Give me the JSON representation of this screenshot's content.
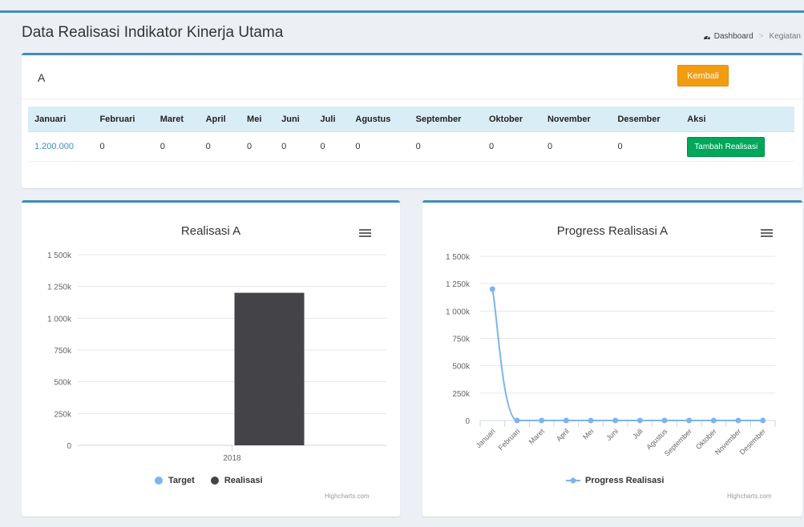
{
  "header": {
    "title": "Data Realisasi Indikator Kinerja Utama",
    "breadcrumb": [
      "Dashboard",
      "Kegiatan"
    ]
  },
  "indicator": {
    "name": "A",
    "back_label": "Kembali"
  },
  "table": {
    "headers": [
      "Januari",
      "Februari",
      "Maret",
      "April",
      "Mei",
      "Juni",
      "Juli",
      "Agustus",
      "September",
      "Oktober",
      "November",
      "Desember",
      "Aksi"
    ],
    "row": [
      "1.200.000",
      "0",
      "0",
      "0",
      "0",
      "0",
      "0",
      "0",
      "0",
      "0",
      "0",
      "0"
    ],
    "action_label": "Tambah Realisasi"
  },
  "colors": {
    "accent": "#3c8dbc",
    "warning": "#f39c12",
    "success": "#00a65a",
    "target": "#7cb5ec",
    "realisasi": "#434348"
  },
  "chart_data": [
    {
      "type": "bar",
      "title": "Realisasi A",
      "categories": [
        "2018"
      ],
      "series": [
        {
          "name": "Target",
          "values": [
            0
          ]
        },
        {
          "name": "Realisasi",
          "values": [
            1200000
          ]
        }
      ],
      "ylim": [
        0,
        1500000
      ],
      "yticks": [
        "0",
        "250k",
        "500k",
        "750k",
        "1 000k",
        "1 250k",
        "1 500k"
      ],
      "legend": "bottom-center",
      "credit": "Highcharts.com"
    },
    {
      "type": "line",
      "title": "Progress Realisasi A",
      "categories": [
        "Januari",
        "Februari",
        "Maret",
        "April",
        "Mei",
        "Juni",
        "Juli",
        "Agustus",
        "September",
        "Oktober",
        "November",
        "Desember"
      ],
      "series": [
        {
          "name": "Progress Realisasi",
          "values": [
            1200000,
            0,
            0,
            0,
            0,
            0,
            0,
            0,
            0,
            0,
            0,
            0
          ]
        }
      ],
      "ylim": [
        0,
        1500000
      ],
      "yticks": [
        "0",
        "250k",
        "500k",
        "750k",
        "1 000k",
        "1 250k",
        "1 500k"
      ],
      "legend": "bottom-center",
      "credit": "Highcharts.com"
    }
  ]
}
